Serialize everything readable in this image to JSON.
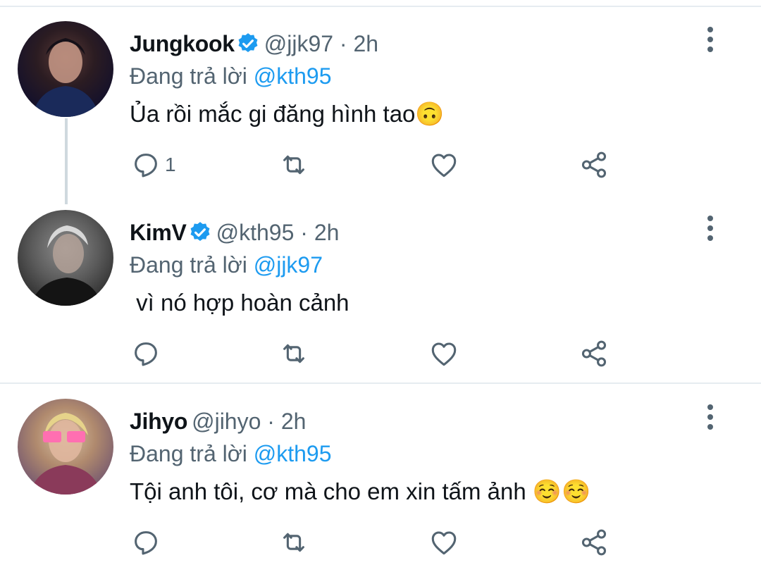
{
  "tweets": [
    {
      "name": "Jungkook",
      "verified": true,
      "handle": "@jjk97 · 2h",
      "replying_prefix": "Đang trả lời ",
      "replying_to": "@kth95",
      "text": "Ủa rồi mắc gi đăng hình tao🙃",
      "reply_count": "1",
      "avatar_icon": "avatar-photo"
    },
    {
      "name": "KimV",
      "verified": true,
      "handle": "@kth95 · 2h",
      "replying_prefix": "Đang trả lời ",
      "replying_to": "@jjk97",
      "text": " vì nó hợp hoàn cảnh",
      "reply_count": "",
      "avatar_icon": "avatar-photo"
    },
    {
      "name": "Jihyo",
      "verified": false,
      "handle": "@jihyo · 2h",
      "replying_prefix": "Đang trả lời ",
      "replying_to": "@kth95",
      "text": "Tội anh tôi, cơ mà cho em xin tấm ảnh ☺️☺️",
      "reply_count": "",
      "avatar_icon": "avatar-photo"
    }
  ],
  "icons": {
    "verified": "verified-badge-icon",
    "more": "more-vertical-icon",
    "reply": "reply-bubble-icon",
    "retweet": "retweet-icon",
    "like": "heart-icon",
    "share": "share-icon"
  },
  "colors": {
    "accent": "#1d9bf0",
    "secondary_text": "#536471",
    "divider": "#e6ecf0"
  }
}
